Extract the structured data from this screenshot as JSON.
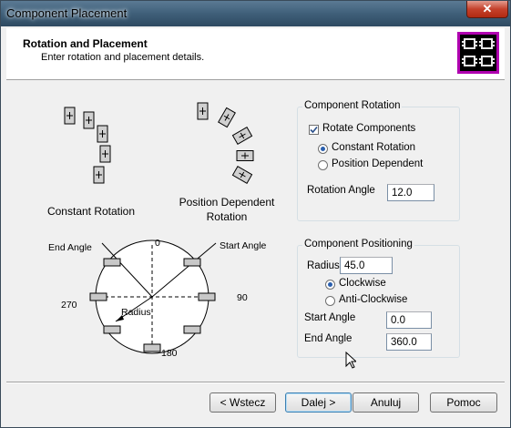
{
  "window": {
    "title": "Component Placement",
    "close_glyph": "✕"
  },
  "header": {
    "title": "Rotation and Placement",
    "subtitle": "Enter rotation and placement details."
  },
  "diagrams": {
    "constant_label": "Constant Rotation",
    "position_label_line1": "Position Dependent",
    "position_label_line2": "Rotation",
    "circle": {
      "end_angle": "End Angle",
      "start_angle": "Start Angle",
      "deg_0": "0",
      "deg_90": "90",
      "deg_180": "180",
      "deg_270": "270",
      "radius": "Radius"
    }
  },
  "rotation_group": {
    "title": "Component Rotation",
    "rotate_label": "Rotate Components",
    "rotate_checked": true,
    "constant_label": "Constant Rotation",
    "position_label": "Position Dependent",
    "selected": "Constant Rotation",
    "angle_label": "Rotation Angle",
    "angle_value": "12.0"
  },
  "positioning_group": {
    "title": "Component Positioning",
    "radius_label": "Radius",
    "radius_value": "45.0",
    "clockwise_label": "Clockwise",
    "anticlockwise_label": "Anti-Clockwise",
    "direction": "Clockwise",
    "start_label": "Start Angle",
    "start_value": "0.0",
    "end_label": "End Angle",
    "end_value": "360.0"
  },
  "buttons": {
    "back": "< Wstecz",
    "next": "Dalej >",
    "cancel": "Anuluj",
    "help": "Pomoc"
  },
  "colors": {
    "icon_bg": "#b000b0",
    "accent": "#2a5fae"
  }
}
